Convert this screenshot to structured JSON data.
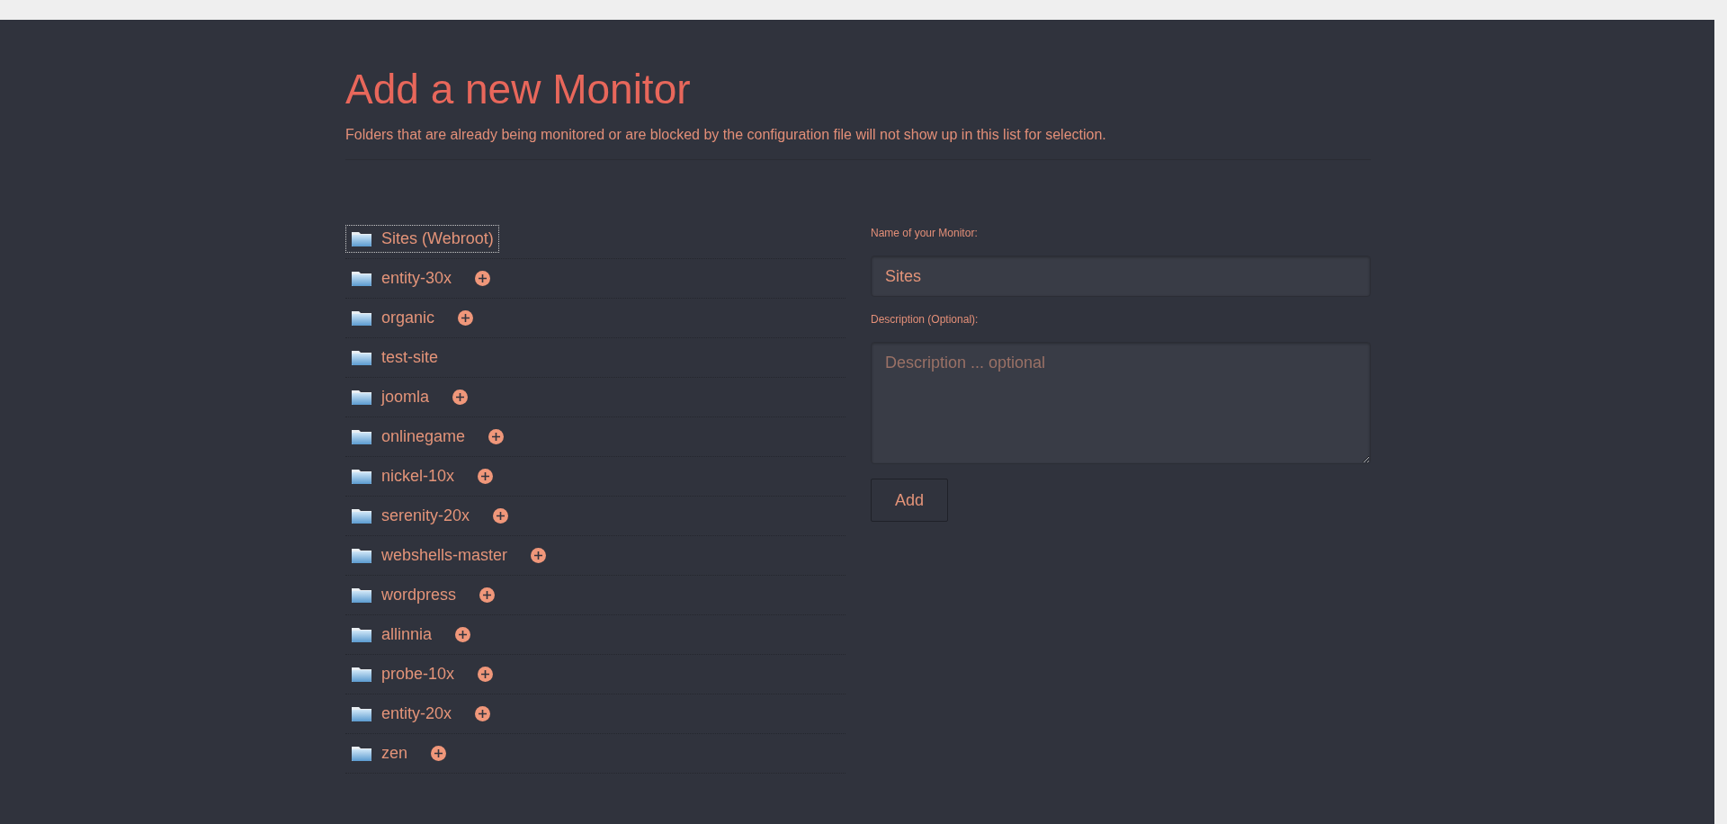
{
  "page": {
    "title": "Add a new Monitor",
    "subtitle": "Folders that are already being monitored or are blocked by the configuration file will not show up in this list for selection."
  },
  "folders": [
    {
      "name": "Sites (Webroot)",
      "selected": true,
      "addable": false
    },
    {
      "name": "entity-30x",
      "selected": false,
      "addable": true
    },
    {
      "name": "organic",
      "selected": false,
      "addable": true
    },
    {
      "name": "test-site",
      "selected": false,
      "addable": false
    },
    {
      "name": "joomla",
      "selected": false,
      "addable": true
    },
    {
      "name": "onlinegame",
      "selected": false,
      "addable": true
    },
    {
      "name": "nickel-10x",
      "selected": false,
      "addable": true
    },
    {
      "name": "serenity-20x",
      "selected": false,
      "addable": true
    },
    {
      "name": "webshells-master",
      "selected": false,
      "addable": true
    },
    {
      "name": "wordpress",
      "selected": false,
      "addable": true
    },
    {
      "name": "allinnia",
      "selected": false,
      "addable": true
    },
    {
      "name": "probe-10x",
      "selected": false,
      "addable": true
    },
    {
      "name": "entity-20x",
      "selected": false,
      "addable": true
    },
    {
      "name": "zen",
      "selected": false,
      "addable": true
    }
  ],
  "form": {
    "name_label": "Name of your Monitor:",
    "name_value": "Sites",
    "description_label": "Description (Optional):",
    "description_placeholder": "Description ... optional",
    "submit": "Add"
  }
}
